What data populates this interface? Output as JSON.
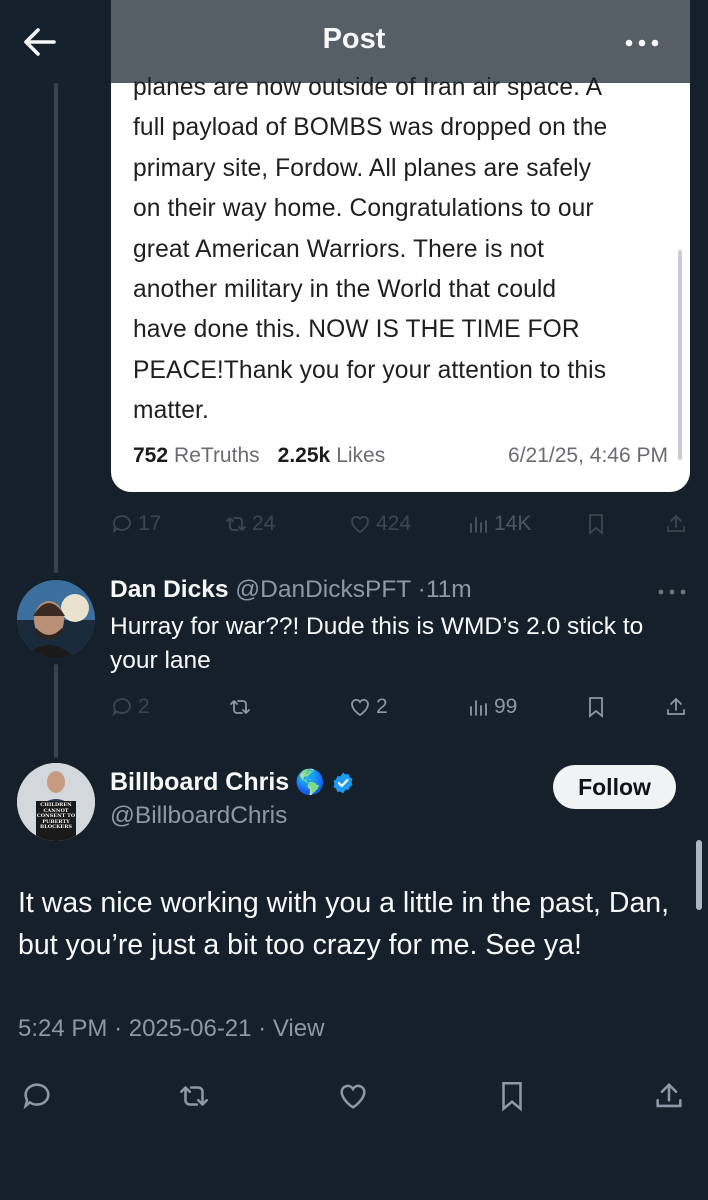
{
  "header": {
    "title": "Post",
    "back_icon": "arrow-left-icon",
    "more_icon": "more-horizontal-icon"
  },
  "embedded_post": {
    "lines": [
      "planes are now outside of Iran air space. A",
      "full payload of BOMBS was dropped on the",
      "primary site, Fordow. All planes are safely",
      "on their way home. Congratulations to our",
      "great American Warriors. There is not",
      "another military in the World that could",
      "have done this. NOW IS THE TIME FOR",
      "PEACE!Thank you for your attention to this",
      "matter."
    ],
    "retruths_count": "752",
    "retruths_label": "ReTruths",
    "likes_count": "2.25k",
    "likes_label": "Likes",
    "date": "6/21/25, 4:46 PM"
  },
  "first_tweet_actions": {
    "replies": "17",
    "reposts": "24",
    "likes": "424",
    "views": "14K"
  },
  "reply": {
    "name": "Dan Dicks",
    "handle": "@DanDicksPFT",
    "separator": "·",
    "time": "11m",
    "text": "Hurray for war??! Dude this is WMD’s 2.0 stick to your lane",
    "actions": {
      "replies": "2",
      "likes": "2",
      "views": "99"
    }
  },
  "main_tweet": {
    "name": "Billboard Chris",
    "emoji": "🌎",
    "handle": "@BillboardChris",
    "follow_label": "Follow",
    "text": "It was nice working with you a little in the past, Dan, but you’re just a bit too crazy for me. See ya!",
    "time": "5:24 PM",
    "dot": "·",
    "date": "2025-06-21",
    "view_label": "View",
    "sign_lines": [
      "CHILDREN",
      "CANNOT",
      "CONSENT TO",
      "PUBERTY",
      "BLOCKERS"
    ]
  },
  "colors": {
    "background": "#15202b",
    "text": "#f7f9f9",
    "muted": "#8b98a5",
    "verified": "#1d9bf0",
    "card": "#ffffff"
  }
}
